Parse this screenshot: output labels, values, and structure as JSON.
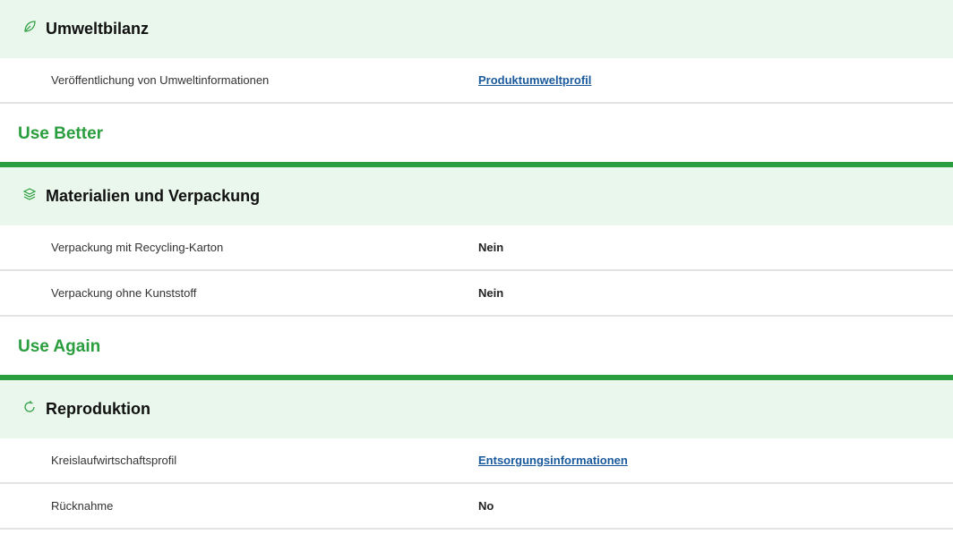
{
  "sections": {
    "umweltbilanz": {
      "title": "Umweltbilanz",
      "icon": "leaf-icon",
      "rows": [
        {
          "label": "Veröffentlichung von Umweltinformationen",
          "value": "Produktumweltprofil",
          "is_link": true
        }
      ]
    },
    "use_better": {
      "heading": "Use Better"
    },
    "materialien": {
      "title": "Materialien und Verpackung",
      "icon": "layers-icon",
      "rows": [
        {
          "label": "Verpackung mit Recycling-Karton",
          "value": "Nein",
          "is_link": false
        },
        {
          "label": "Verpackung ohne Kunststoff",
          "value": "Nein",
          "is_link": false
        }
      ]
    },
    "use_again": {
      "heading": "Use Again"
    },
    "reproduktion": {
      "title": "Reproduktion",
      "icon": "refresh-icon",
      "rows": [
        {
          "label": "Kreislaufwirtschaftsprofil",
          "value": "Entsorgungsinformationen",
          "is_link": true
        },
        {
          "label": "Rücknahme",
          "value": "No",
          "is_link": false
        }
      ]
    }
  },
  "colors": {
    "accent_green": "#2a9d3e",
    "header_bg": "#eaf7ec",
    "link_blue": "#1a5a9c"
  }
}
